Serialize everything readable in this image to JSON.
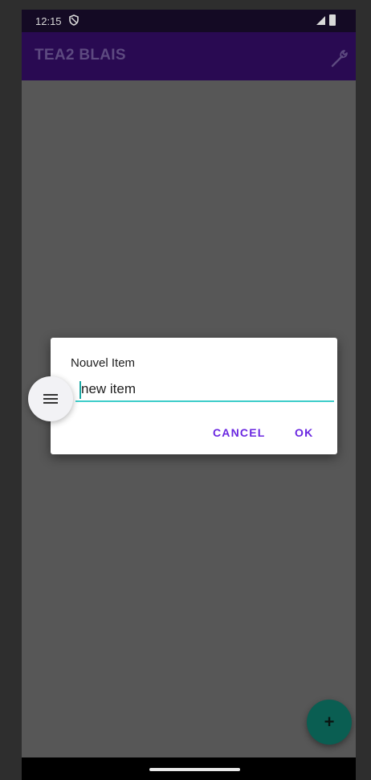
{
  "status_bar": {
    "time": "12:15",
    "icons": [
      "shield-icon",
      "signal-icon",
      "battery-icon"
    ]
  },
  "app_bar": {
    "title": "TEA2 BLAIS",
    "action_icon": "wrench-icon"
  },
  "dialog": {
    "title": "Nouvel Item",
    "input_value": "new item",
    "accent_color": "#3ccdc9",
    "cancel_label": "CANCEL",
    "ok_label": "OK",
    "button_color": "#6a27e0"
  },
  "floating_menu": {
    "icon": "hamburger-menu-icon"
  },
  "fab": {
    "icon": "plus-icon",
    "label": "+",
    "color": "#0a5e52"
  },
  "colors": {
    "app_bar": "#290a52",
    "status_bar": "#140a24",
    "scrim_background": "#575757"
  }
}
